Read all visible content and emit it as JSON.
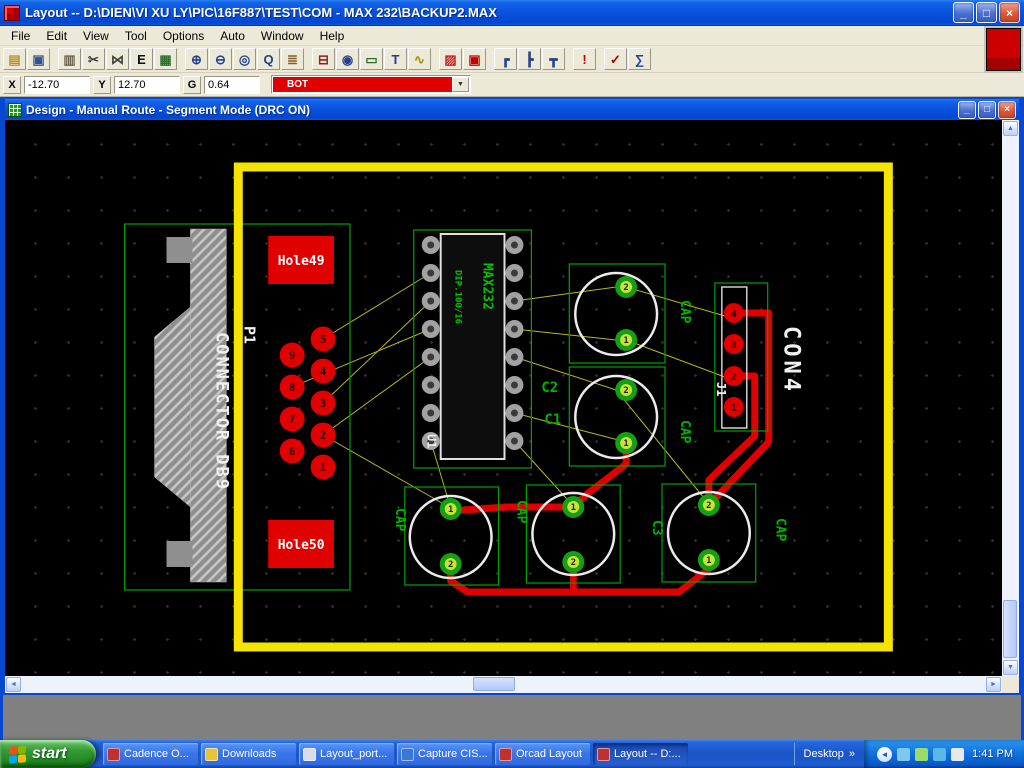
{
  "window": {
    "title": "Layout -- D:\\DIEN\\VI XU LY\\PIC\\16F887\\TEST\\COM - MAX 232\\BACKUP2.MAX",
    "controls": {
      "minimize": "_",
      "maximize": "□",
      "close": "×"
    }
  },
  "menu": {
    "items": [
      "File",
      "Edit",
      "View",
      "Tool",
      "Options",
      "Auto",
      "Window",
      "Help"
    ]
  },
  "toolbar": {
    "items": [
      {
        "name": "open-file",
        "glyph": "▤",
        "color": "#b99121"
      },
      {
        "name": "save-file",
        "glyph": "▣",
        "color": "#34548e"
      },
      {
        "sep": true
      },
      {
        "name": "library-manager",
        "glyph": "▥",
        "color": "#6b6350"
      },
      {
        "name": "delete-mode",
        "glyph": "✂",
        "color": "#3e3e3e"
      },
      {
        "name": "find",
        "glyph": "⋈",
        "color": "#3e3e3e"
      },
      {
        "name": "edit-mode",
        "glyph": "E",
        "color": "#101010"
      },
      {
        "name": "spreadsheet",
        "glyph": "▦",
        "color": "#2f6b2f"
      },
      {
        "sep": true
      },
      {
        "name": "zoom-in",
        "glyph": "⊕",
        "color": "#24418c"
      },
      {
        "name": "zoom-out",
        "glyph": "⊖",
        "color": "#24418c"
      },
      {
        "name": "zoom-all",
        "glyph": "◎",
        "color": "#24418c"
      },
      {
        "name": "query",
        "glyph": "Q",
        "color": "#24418c"
      },
      {
        "name": "measurement",
        "glyph": "≣",
        "color": "#865e24"
      },
      {
        "sep": true
      },
      {
        "name": "component-tool",
        "glyph": "⊟",
        "color": "#8e2222"
      },
      {
        "name": "pin-tool",
        "glyph": "◉",
        "color": "#24418c"
      },
      {
        "name": "obstacle-tool",
        "glyph": "▭",
        "color": "#2f6b2f"
      },
      {
        "name": "text-tool",
        "glyph": "T",
        "color": "#2438aa"
      },
      {
        "name": "connection-tool",
        "glyph": "∿",
        "color": "#9b8f10"
      },
      {
        "sep": true
      },
      {
        "name": "color-settings",
        "glyph": "▨",
        "color": "#c42222"
      },
      {
        "name": "online-drc",
        "glyph": "▣",
        "color": "#c40000"
      },
      {
        "sep": true
      },
      {
        "name": "add-edit-route-mode",
        "glyph": "┏",
        "color": "#24418c"
      },
      {
        "name": "shove-track-mode",
        "glyph": "┣",
        "color": "#24418c"
      },
      {
        "name": "edit-segment-mode",
        "glyph": "┳",
        "color": "#24418c"
      },
      {
        "sep": true
      },
      {
        "name": "error-marker",
        "glyph": "!",
        "color": "#c40000"
      },
      {
        "sep": true
      },
      {
        "name": "design-rule-check",
        "glyph": "✓",
        "color": "#a80000"
      },
      {
        "name": "statistics",
        "glyph": "∑",
        "color": "#24418c"
      }
    ]
  },
  "coordbar": {
    "x_label": "X",
    "x_value": "-12.70",
    "y_label": "Y",
    "y_value": "12.70",
    "g_label": "G",
    "g_value": "0.64",
    "layer_selected": "BOT",
    "arrow": "▼"
  },
  "child_window": {
    "title": "Design - Manual Route - Segment Mode (DRC ON)",
    "controls": {
      "minimize": "_",
      "maximize": "□",
      "close": "×"
    }
  },
  "icons": {
    "up": "▲",
    "down": "▼",
    "left": "◄",
    "right": "►",
    "tray_chevron": "◄"
  },
  "pcb": {
    "board_outline_color": "#f5e400",
    "trace_color": "#e00000",
    "db9": {
      "ref": "P1",
      "footprint": "CONNECTOR DB9",
      "hole_top": "Hole49",
      "hole_bottom": "Hole50",
      "pad_numbers": [
        "5",
        "4",
        "3",
        "2",
        "1",
        "9",
        "8",
        "7",
        "6"
      ]
    },
    "ic": {
      "ref": "U1",
      "value": "MAX232",
      "footprint": "DIP.100/16"
    },
    "caps": [
      {
        "ref": "C2",
        "footprint": "CAP",
        "pads": [
          "2",
          "1"
        ]
      },
      {
        "ref": "C1",
        "footprint": "CAP",
        "pads": [
          "2",
          "1"
        ]
      },
      {
        "footprint": "CAP",
        "pads": [
          "1",
          "2"
        ]
      },
      {
        "footprint": "CAP",
        "pads": [
          "1",
          "2"
        ]
      },
      {
        "ref": "C3",
        "footprint": "CAP",
        "pads": [
          "2",
          "1"
        ]
      }
    ],
    "con4": {
      "ref": "J1",
      "value": "CON4",
      "pad_numbers": [
        "4",
        "3",
        "2",
        "1"
      ]
    }
  },
  "taskbar": {
    "start_label": "start",
    "flag_colors": [
      "#f25022",
      "#7fba00",
      "#05a6f0",
      "#ffb900"
    ],
    "buttons": [
      {
        "label": "Cadence O...",
        "icon": "cadence",
        "icon_color": "#c03030"
      },
      {
        "label": "Downloads",
        "icon": "downloads-folder",
        "icon_color": "#e8c23a"
      },
      {
        "label": "Layout_port...",
        "icon": "layout-doc",
        "icon_color": "#d8dce8"
      },
      {
        "label": "Capture CIS...",
        "icon": "capture-cis",
        "icon_color": "#3a78d8"
      },
      {
        "label": "Orcad Layout",
        "icon": "orcad-layout",
        "icon_color": "#c03030"
      },
      {
        "label": "Layout -- D:...",
        "icon": "layout-app",
        "icon_color": "#c03030",
        "active": true
      }
    ],
    "desktop_label": "Desktop",
    "desktop_chevron": "»",
    "tray_icons": [
      {
        "name": "tray-display",
        "color": "#7ec8f0"
      },
      {
        "name": "tray-safely-remove",
        "color": "#9adb6a"
      },
      {
        "name": "tray-network",
        "color": "#58b8e8"
      },
      {
        "name": "tray-volume",
        "color": "#e8e8e8"
      }
    ],
    "tray_time": "1:41 PM"
  }
}
